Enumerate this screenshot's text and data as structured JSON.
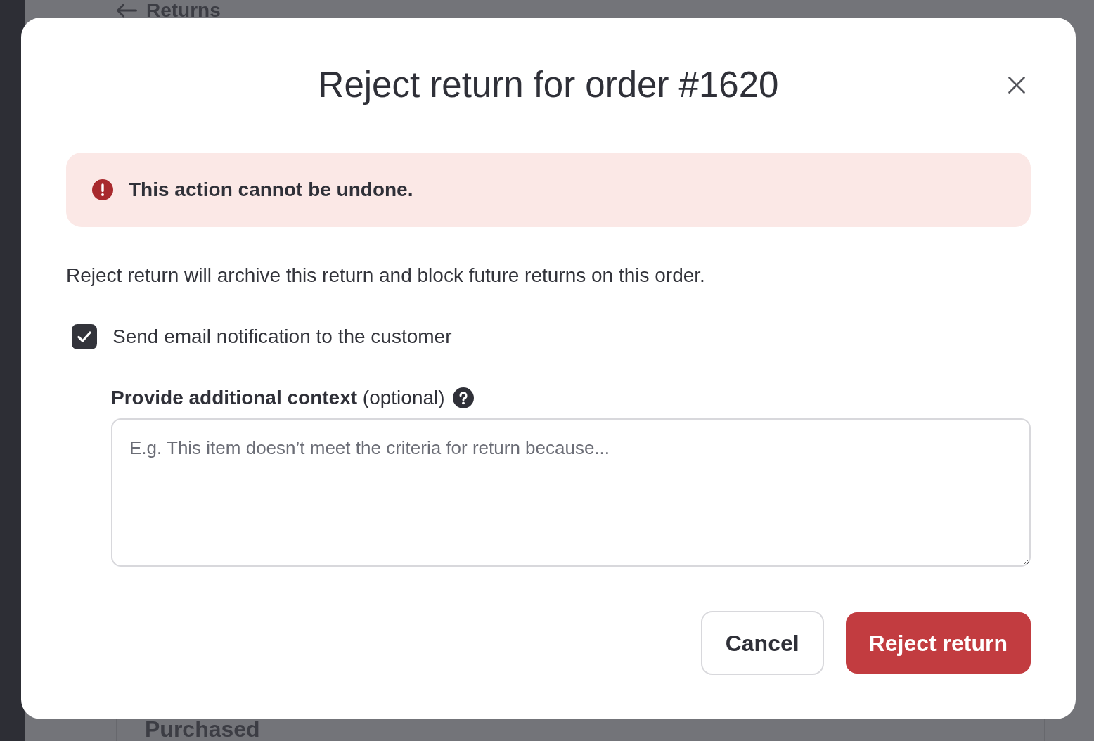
{
  "background": {
    "back_link": {
      "label": "Returns"
    },
    "section_heading": "Purchased"
  },
  "dialog": {
    "title": "Reject return for order #1620",
    "alert": {
      "kind": "error",
      "message": "This action cannot be undone."
    },
    "description": "Reject return will archive this return and block future returns on this order.",
    "notify_checkbox": {
      "label": "Send email notification to the customer",
      "checked": true
    },
    "context_field": {
      "label": "**Provide additional context** (optional)",
      "placeholder": "E.g. This item doesn’t meet the criteria for return because..."
    },
    "buttons": [
      {
        "label": "Cancel",
        "kind": "secondary"
      },
      {
        "label": "Reject return",
        "kind": "danger"
      }
    ]
  }
}
